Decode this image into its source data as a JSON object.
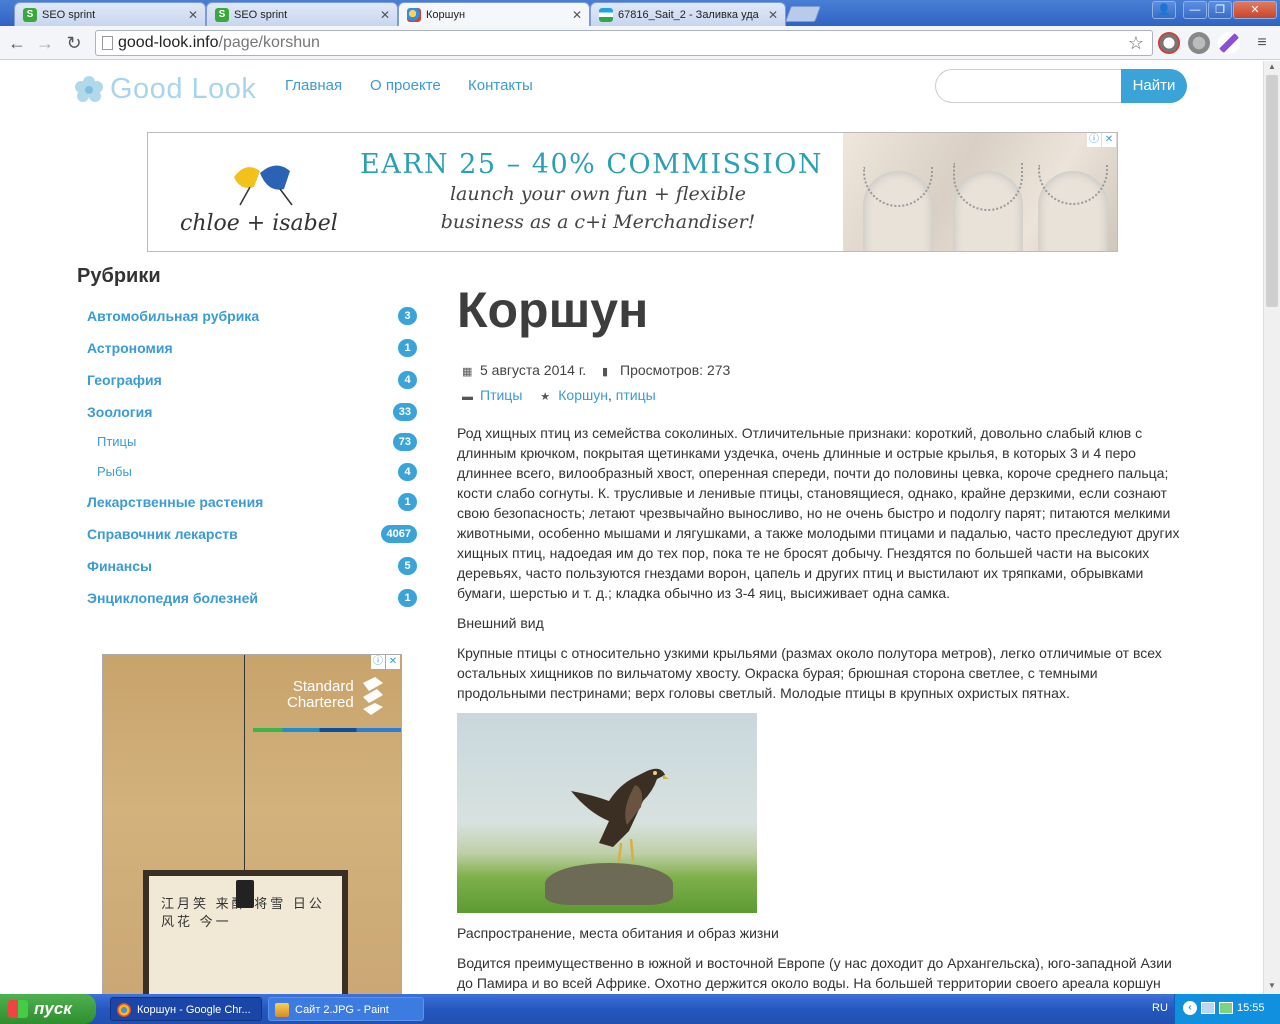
{
  "browser": {
    "tabs": [
      {
        "label": "SEO sprint"
      },
      {
        "label": "SEO sprint"
      },
      {
        "label": "Коршун"
      },
      {
        "label": "67816_Sait_2 - Заливка уда"
      }
    ],
    "url_domain": "good-look.info",
    "url_path": "/page/korshun"
  },
  "site": {
    "logo_text": "Good Look",
    "nav": [
      "Главная",
      "О проекте",
      "Контакты"
    ],
    "search_placeholder": "",
    "search_button": "Найти"
  },
  "banner_ad": {
    "brand": "chloe + isabel",
    "headline": "EARN 25 – 40% COMMISSION",
    "line1": "launch your own fun + flexible",
    "line2": "business as a c+i Merchandiser!"
  },
  "sidebar": {
    "title": "Рубрики",
    "categories": [
      {
        "label": "Автомобильная рубрика",
        "count": "3"
      },
      {
        "label": "Астрономия",
        "count": "1"
      },
      {
        "label": "География",
        "count": "4"
      },
      {
        "label": "Зоология",
        "count": "33"
      },
      {
        "label": "Птицы",
        "count": "73"
      },
      {
        "label": "Рыбы",
        "count": "4"
      },
      {
        "label": "Лекарственные растения",
        "count": "1"
      },
      {
        "label": "Справочник лекарств",
        "count": "4067"
      },
      {
        "label": "Финансы",
        "count": "5"
      },
      {
        "label": "Энциклопедия болезней",
        "count": "1"
      }
    ]
  },
  "side_ad": {
    "brand_line1": "Standard",
    "brand_line2": "Chartered",
    "glyphs": "江月笑 来醉 将雪 日公 风花 今一"
  },
  "article": {
    "title": "Коршун",
    "date": "5 августа 2014 г.",
    "views": "Просмотров: 273",
    "category": "Птицы",
    "tag1": "Коршун",
    "tag_sep": ",",
    "tag2": "птицы",
    "p1": "Род хищных птиц из семейства соколиных. Отличительные признаки: короткий, довольно слабый клюв с длинным крючком, покрытая щетинками уздечка, очень длинные и острые крылья, в которых 3 и 4 перо длиннее всего, вилообразный хвост, оперенная спереди, почти до половины цевка, короче среднего пальца; кости слабо согнуты. К. трусливые и ленивые птицы, становящиеся, однако, крайне дерзкими, если сознают свою безопасность; летают чрезвычайно выносливо, но не очень быстро и подолгу парят; питаются мелкими животными, особенно мышами и лягушками, а также молодыми птицами и падалью, часто преследуют других хищных птиц, надоедая им до тех пор, пока те не бросят добычу. Гнездятся по большей части на высоких деревьях, часто пользуются гнездами ворон, цапель и других птиц и выстилают их тряпками, обрывками бумаги, шерстью и т. д.; кладка обычно из 3-4 яиц, высиживает одна самка.",
    "h_appearance": "Внешний вид",
    "p2": "Крупные птицы с относительно узкими крыльями (размах около полутора метров), легко отличимые от всех остальных хищников по вильчатому хвосту. Окраска бурая; брюшная сторона светлее, с темными продольными пестринами; верх головы светлый. Молодые птицы в крупных охристых пятнах.",
    "h_habitat": "Распространение, места обитания и образ жизни",
    "p3": "Водится преимущественно в южной и восточной Европе (у нас доходит до Архангельска), юго-западной Азии до Памира и во всей Африке. Охотно держится около воды. На большей территории своего ареала коршун"
  },
  "taskbar": {
    "start": "пуск",
    "tasks": [
      "Коршун - Google Chr...",
      "Сайт 2.JPG - Paint"
    ],
    "lang": "RU",
    "time": "15:55"
  }
}
